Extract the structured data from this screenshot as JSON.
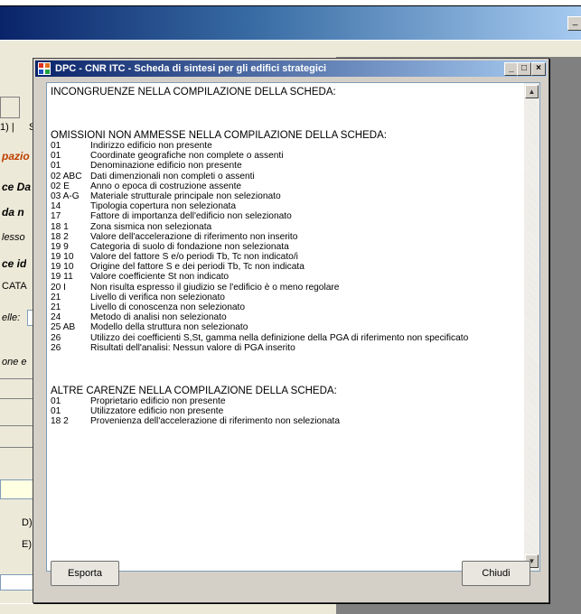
{
  "background": {
    "fragments": [
      "1) |",
      "S",
      "pazio",
      "ce Da",
      "da n",
      "lesso",
      "ce id",
      "CATA",
      "elle:",
      "one e",
      "D)",
      "E)"
    ],
    "min_glyph": "_"
  },
  "dialog": {
    "title": "DPC - CNR ITC - Scheda di sintesi per gli edifici strategici",
    "controls": {
      "minimize": "_",
      "maximize": "□",
      "close": "×"
    },
    "sections": [
      {
        "heading": "INCONGRUENZE NELLA COMPILAZIONE DELLA SCHEDA:",
        "items": []
      },
      {
        "heading": "OMISSIONI NON AMMESSE NELLA COMPILAZIONE DELLA SCHEDA:",
        "items": [
          {
            "code": "01",
            "text": "Indirizzo edificio non presente"
          },
          {
            "code": "01",
            "text": "Coordinate geografiche non complete o assenti"
          },
          {
            "code": "01",
            "text": "Denominazione edificio non presente"
          },
          {
            "code": "02 ABC",
            "text": "Dati dimenzionali non completi o assenti"
          },
          {
            "code": "02 E",
            "text": "Anno o epoca di costruzione assente"
          },
          {
            "code": "03 A-G",
            "text": "Materiale strutturale principale non selezionato"
          },
          {
            "code": "14",
            "text": "Tipologia copertura non selezionata"
          },
          {
            "code": "17",
            "text": "Fattore di importanza dell'edificio non selezionato"
          },
          {
            "code": "18 1",
            "text": "Zona sismica non selezionata"
          },
          {
            "code": "18 2",
            "text": "Valore dell'accelerazione di riferimento non inserito"
          },
          {
            "code": "19 9",
            "text": "Categoria di suolo di fondazione non selezionata"
          },
          {
            "code": "19 10",
            "text": "Valore del fattore S e/o periodi Tb, Tc non indicato/i"
          },
          {
            "code": "19 10",
            "text": "Origine del fattore S e dei periodi Tb, Tc non indicata"
          },
          {
            "code": "19 11",
            "text": "Valore coefficiente St non indicato"
          },
          {
            "code": "20 I",
            "text": "Non risulta espresso il giudizio se l'edificio è o meno regolare"
          },
          {
            "code": "21",
            "text": "Livello di verifica non selezionato"
          },
          {
            "code": "21",
            "text": "Livello di conoscenza non selezionato"
          },
          {
            "code": "24",
            "text": "Metodo di analisi non selezionato"
          },
          {
            "code": "25 AB",
            "text": "Modello della struttura non selezionato"
          },
          {
            "code": "26",
            "text": "Utilizzo dei coefficienti S,St, gamma nella definizione della PGA di riferimento non specificato"
          },
          {
            "code": "26",
            "text": "Risultati dell'analisi: Nessun valore di PGA inserito"
          }
        ]
      },
      {
        "heading": "ALTRE CARENZE NELLA COMPILAZIONE DELLA SCHEDA:",
        "items": [
          {
            "code": "01",
            "text": "Proprietario edificio non presente"
          },
          {
            "code": "01",
            "text": "Utilizzatore edificio non presente"
          },
          {
            "code": "18 2",
            "text": "Provenienza dell'accelerazione di riferimento non selezionata"
          }
        ]
      }
    ],
    "buttons": {
      "export": "Esporta",
      "close": "Chiudi"
    },
    "scroll": {
      "up": "▲",
      "down": "▼"
    }
  }
}
